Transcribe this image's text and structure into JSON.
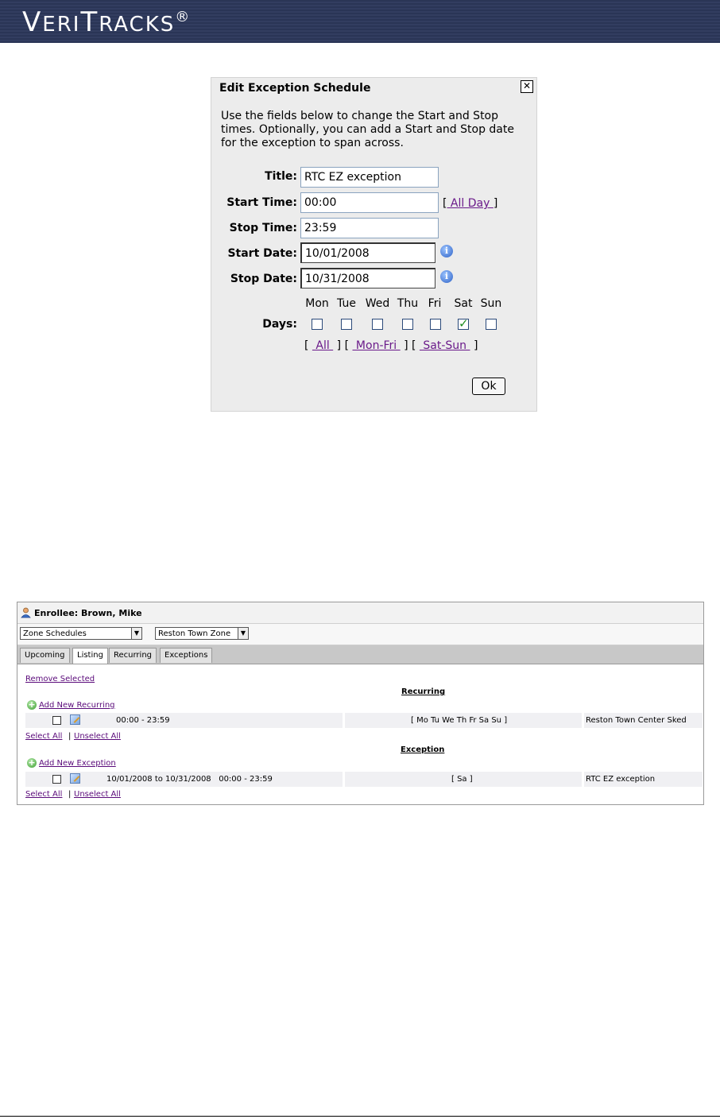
{
  "banner": {
    "logo_big_V": "V",
    "logo_eri": "ERI",
    "logo_big_T": "T",
    "logo_racks": "RACKS",
    "logo_reg": "®"
  },
  "dialog": {
    "title": "Edit Exception Schedule",
    "close_symbol": "✕",
    "description": "Use the fields below to change the Start and Stop times. Optionally, you can add a Start and Stop date for the exception to span across.",
    "title_label": "Title:",
    "title_value": "RTC EZ exception",
    "start_time_label": "Start Time:",
    "start_time_value": "00:00",
    "all_day_prefix": "[",
    "all_day_link": " All Day ",
    "all_day_suffix": "]",
    "stop_time_label": "Stop Time:",
    "stop_time_value": "23:59",
    "start_date_label": "Start Date:",
    "start_date_value": "10/01/2008",
    "stop_date_label": "Stop Date:",
    "stop_date_value": "10/31/2008",
    "info_symbol": "i",
    "days_label": "Days:",
    "days": [
      {
        "name": "Mon",
        "checked": false
      },
      {
        "name": "Tue",
        "checked": false
      },
      {
        "name": "Wed",
        "checked": false
      },
      {
        "name": "Thu",
        "checked": false
      },
      {
        "name": "Fri",
        "checked": false
      },
      {
        "name": "Sat",
        "checked": true
      },
      {
        "name": "Sun",
        "checked": false
      }
    ],
    "bracket_open": "[",
    "bracket_close": "]",
    "link_all": " All ",
    "link_mon_fri": " Mon-Fri ",
    "link_sat_sun": " Sat-Sun ",
    "ok_label": "Ok"
  },
  "panel": {
    "enrollee": "Enrollee: Brown, Mike",
    "select_schedule_type": "Zone Schedules",
    "select_zone": "Reston Town Zone",
    "select_arrow": "▼",
    "tabs": [
      "Upcoming",
      "Listing",
      "Recurring",
      "Exceptions"
    ],
    "active_tab": "Listing",
    "remove_selected": "Remove Selected",
    "recurring_heading": "Recurring",
    "add_new_recurring": " Add New Recurring",
    "add_symbol": "+",
    "recurring_row": {
      "time": "00:00 - 23:59",
      "days": "[ Mo Tu We Th Fr Sa Su ]",
      "name": "Reston Town Center Sked"
    },
    "select_all": "Select All",
    "pipe": "|",
    "unselect_all": "Unselect All",
    "exception_heading": "Exception",
    "add_new_exception": " Add New Exception",
    "exception_row": {
      "time": "10/01/2008 to 10/31/2008   00:00 - 23:59",
      "days": "[ Sa ]",
      "name": "RTC EZ exception"
    }
  }
}
